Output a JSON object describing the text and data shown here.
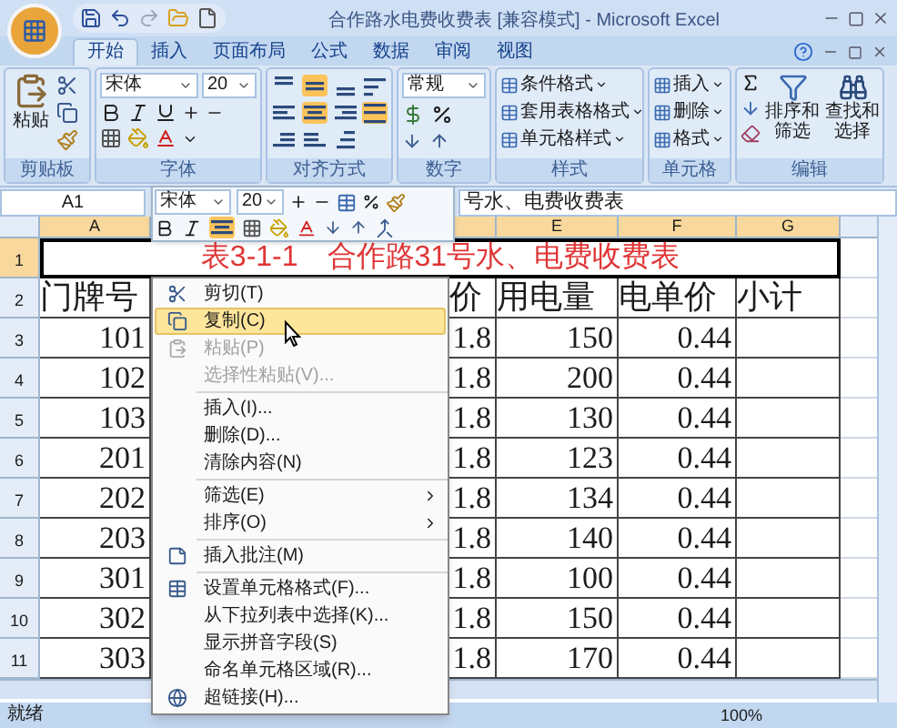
{
  "window": {
    "title": "合作路水电费收费表 [兼容模式] - Microsoft Excel"
  },
  "tabs": [
    {
      "label": "开始",
      "selected": true
    },
    {
      "label": "插入",
      "selected": false
    },
    {
      "label": "页面布局",
      "selected": false
    },
    {
      "label": "公式",
      "selected": false
    },
    {
      "label": "数据",
      "selected": false
    },
    {
      "label": "审阅",
      "selected": false
    },
    {
      "label": "视图",
      "selected": false
    }
  ],
  "ribbon": {
    "clipboard": {
      "title": "剪贴板",
      "paste": "粘贴"
    },
    "font": {
      "title": "字体",
      "font_name": "宋体",
      "font_size": "20"
    },
    "alignment": {
      "title": "对齐方式",
      "buttons": [
        {
          "selected": false
        },
        {
          "selected": true
        },
        {
          "selected": false
        },
        {
          "selected": false
        },
        {
          "selected": false
        },
        {
          "selected": true
        },
        {
          "selected": false
        },
        {
          "selected": true
        },
        {
          "selected": false
        },
        {
          "selected": false
        },
        {
          "selected": false
        }
      ]
    },
    "number": {
      "title": "数字",
      "format": "常规"
    },
    "styles": {
      "title": "样式",
      "items": [
        "条件格式",
        "套用表格格式",
        "单元格样式"
      ]
    },
    "cells": {
      "title": "单元格",
      "items": [
        "插入",
        "删除",
        "格式"
      ]
    },
    "editing": {
      "title": "编辑",
      "sort": "排序和筛选",
      "find": "查找和选择"
    }
  },
  "formula_bar": {
    "name_box": "A1",
    "formula": "号水、电费收费表"
  },
  "mini_toolbar": {
    "font_name": "宋体",
    "font_size": "20",
    "center_selected": true
  },
  "sheet": {
    "columns": [
      {
        "label": "A",
        "selected": true
      },
      {
        "selected": true
      },
      {
        "label": "E",
        "selected": true
      },
      {
        "label": "F",
        "selected": true
      },
      {
        "label": "G",
        "selected": true
      }
    ],
    "title_row": {
      "header": "1",
      "selected": true,
      "text": "表3-1-1　合作路31号水、电费收费表"
    },
    "rows": [
      {
        "header": "2",
        "selected": false,
        "kind": "heading",
        "cells": [
          "门牌号",
          "价",
          "用电量",
          "电单价",
          "小计"
        ]
      },
      {
        "header": "3",
        "selected": false,
        "kind": "data",
        "cells": [
          "101",
          "1.8",
          "150",
          "0.44"
        ]
      },
      {
        "header": "4",
        "selected": false,
        "kind": "data",
        "cells": [
          "102",
          "1.8",
          "200",
          "0.44"
        ]
      },
      {
        "header": "5",
        "selected": false,
        "kind": "data",
        "cells": [
          "103",
          "1.8",
          "130",
          "0.44"
        ]
      },
      {
        "header": "6",
        "selected": false,
        "kind": "data",
        "cells": [
          "201",
          "1.8",
          "123",
          "0.44"
        ]
      },
      {
        "header": "7",
        "selected": false,
        "kind": "data",
        "cells": [
          "202",
          "1.8",
          "134",
          "0.44"
        ]
      },
      {
        "header": "8",
        "selected": false,
        "kind": "data",
        "cells": [
          "203",
          "1.8",
          "140",
          "0.44"
        ]
      },
      {
        "header": "9",
        "selected": false,
        "kind": "data",
        "cells": [
          "301",
          "1.8",
          "100",
          "0.44"
        ]
      },
      {
        "header": "10",
        "selected": false,
        "kind": "data",
        "cells": [
          "302",
          "1.8",
          "150",
          "0.44"
        ]
      },
      {
        "header": "11",
        "selected": false,
        "kind": "data",
        "cells": [
          "303",
          "1.8",
          "170",
          "0.44"
        ]
      }
    ]
  },
  "context_menu": {
    "groups": [
      [
        {
          "label": "剪切(T)",
          "selected": false,
          "disabled": false,
          "submenu": false
        },
        {
          "label": "复制(C)",
          "selected": true,
          "disabled": false,
          "submenu": false
        },
        {
          "label": "粘贴(P)",
          "selected": false,
          "disabled": true,
          "submenu": false
        },
        {
          "label": "选择性粘贴(V)...",
          "selected": false,
          "disabled": true,
          "submenu": false
        }
      ],
      [
        {
          "label": "插入(I)...",
          "selected": false,
          "disabled": false,
          "submenu": false
        },
        {
          "label": "删除(D)...",
          "selected": false,
          "disabled": false,
          "submenu": false
        },
        {
          "label": "清除内容(N)",
          "selected": false,
          "disabled": false,
          "submenu": false
        }
      ],
      [
        {
          "label": "筛选(E)",
          "selected": false,
          "disabled": false,
          "submenu": true
        },
        {
          "label": "排序(O)",
          "selected": false,
          "disabled": false,
          "submenu": true
        }
      ],
      [
        {
          "label": "插入批注(M)",
          "selected": false,
          "disabled": false,
          "submenu": false
        }
      ],
      [
        {
          "label": "设置单元格格式(F)...",
          "selected": false,
          "disabled": false,
          "submenu": false
        },
        {
          "label": "从下拉列表中选择(K)...",
          "selected": false,
          "disabled": false,
          "submenu": false
        },
        {
          "label": "显示拼音字段(S)",
          "selected": false,
          "disabled": false,
          "submenu": false
        },
        {
          "label": "命名单元格区域(R)...",
          "selected": false,
          "disabled": false,
          "submenu": false
        },
        {
          "label": "超链接(H)...",
          "selected": false,
          "disabled": false,
          "submenu": false
        }
      ]
    ]
  },
  "status_bar": {
    "status": "就绪",
    "zoom": "100%"
  }
}
